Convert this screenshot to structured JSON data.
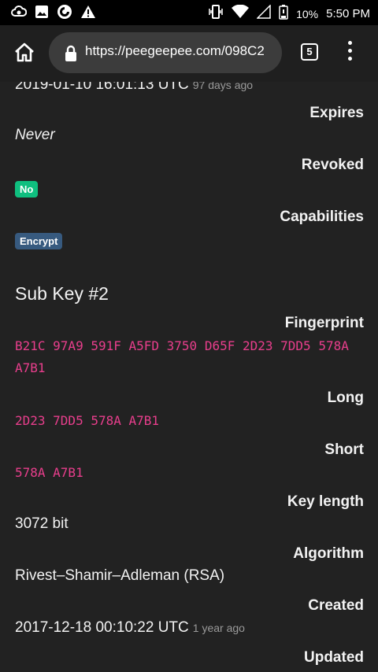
{
  "status_bar": {
    "battery": "10%",
    "time": "5:50 PM",
    "icons_left": [
      "cloud-sync-icon",
      "image-icon",
      "firefox-icon",
      "warning-icon"
    ],
    "icons_right": [
      "vibrate-icon",
      "wifi-icon",
      "signal-icon",
      "battery-icon"
    ]
  },
  "toolbar": {
    "url": "https://peegeepee.com/098C2",
    "tab_count": "5"
  },
  "content": {
    "top_date": "2019-01-10 16:01:13 UTC",
    "top_ago": "97 days ago",
    "expires_label": "Expires",
    "expires_value": "Never",
    "revoked_label": "Revoked",
    "revoked_value": "No",
    "capabilities_label": "Capabilities",
    "capabilities_value": "Encrypt",
    "subkey_heading": "Sub Key #2",
    "fingerprint_label": "Fingerprint",
    "fingerprint_line1": "B21C 97A9 591F A5FD 3750 D65F 2D23 7DD5 578A",
    "fingerprint_line2": "A7B1",
    "long_label": "Long",
    "long_value": "2D23 7DD5 578A A7B1",
    "short_label": "Short",
    "short_value": "578A A7B1",
    "keylength_label": "Key length",
    "keylength_value": "3072 bit",
    "algorithm_label": "Algorithm",
    "algorithm_value": "Rivest–Shamir–Adleman (RSA)",
    "created_label": "Created",
    "created_value": "2017-12-18 00:10:22 UTC",
    "created_ago": "1 year ago",
    "updated_label": "Updated"
  },
  "colors": {
    "background": "#222222",
    "badge_green": "#0fbf7f",
    "badge_blue": "#375a7f",
    "code_pink": "#e83e8c"
  }
}
